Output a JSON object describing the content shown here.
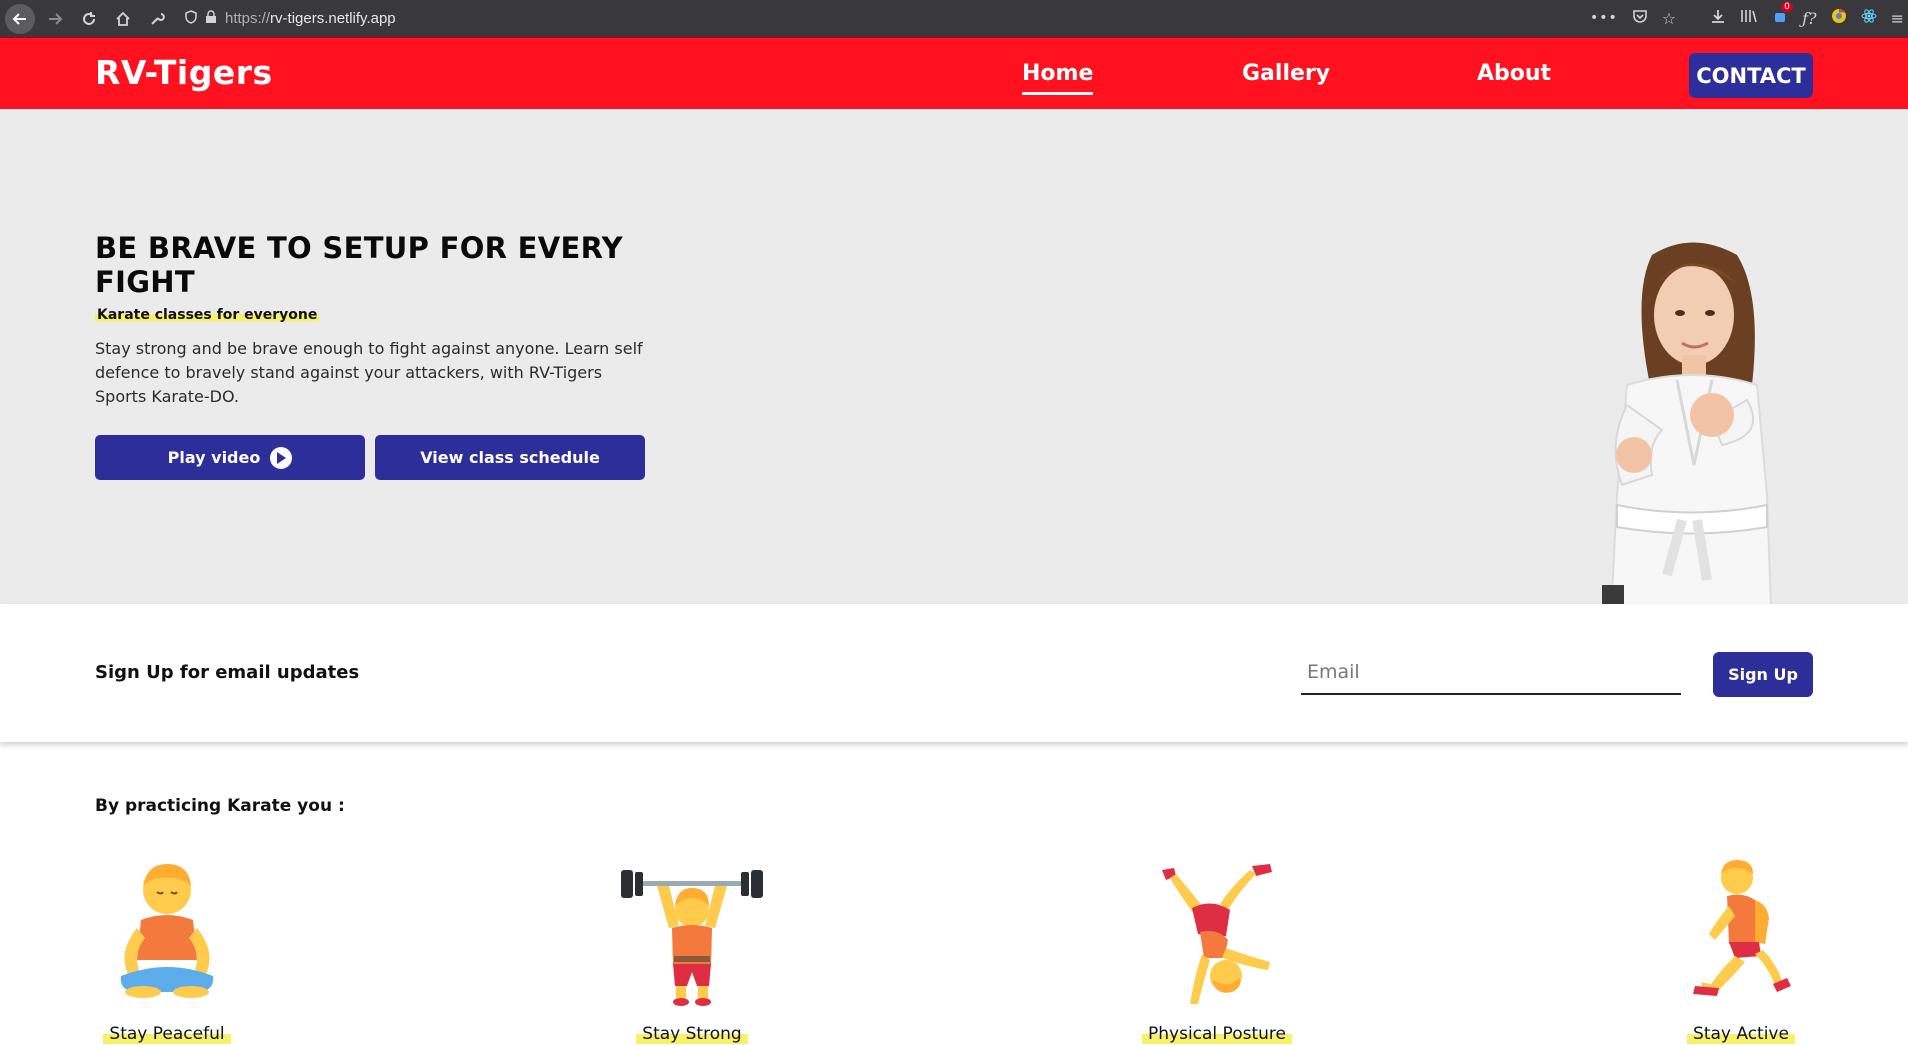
{
  "browser": {
    "url_protocol": "https://",
    "url_host": "rv-tigers.netlify.app",
    "notification_count": "0"
  },
  "header": {
    "logo": "RV-Tigers",
    "nav": [
      {
        "label": "Home",
        "active": true
      },
      {
        "label": "Gallery",
        "active": false
      },
      {
        "label": "About",
        "active": false
      }
    ],
    "contact_label": "CONTACT"
  },
  "hero": {
    "title": "BE BRAVE TO SETUP FOR EVERY FIGHT",
    "subtitle": "Karate classes for everyone",
    "description": "Stay strong and be brave enough to fight against anyone. Learn self defence to bravely stand against your attackers, with RV-Tigers Sports Karate-DO.",
    "play_video_label": "Play video",
    "schedule_label": "View class schedule"
  },
  "signup": {
    "label": "Sign Up for email updates",
    "email_placeholder": "Email",
    "email_value": "",
    "button_label": "Sign Up"
  },
  "benefits": {
    "title": "By practicing Karate you :",
    "items": [
      {
        "label": "Stay Peaceful",
        "icon": "meditation-icon"
      },
      {
        "label": "Stay Strong",
        "icon": "weightlifter-icon"
      },
      {
        "label": "Physical Posture",
        "icon": "cartwheel-icon"
      },
      {
        "label": "Stay Active",
        "icon": "runner-icon"
      }
    ]
  },
  "colors": {
    "header_red": "#ff111f",
    "button_blue": "#2e2e9a",
    "hero_bg": "#ebebeb",
    "highlight_yellow": "#f7f06a"
  }
}
